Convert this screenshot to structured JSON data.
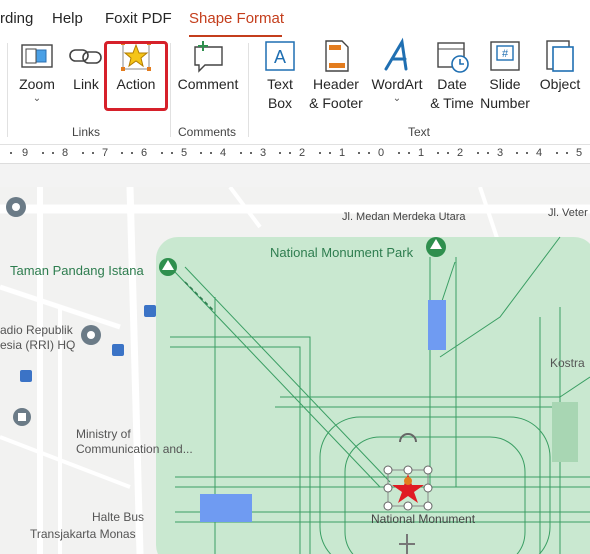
{
  "menu": {
    "items": [
      "rding",
      "Help",
      "Foxit PDF",
      "Shape Format"
    ]
  },
  "ribbon": {
    "buttons": {
      "zoom": "Zoom",
      "link": "Link",
      "action": "Action",
      "comment": "Comment",
      "textbox_1": "Text",
      "textbox_2": "Box",
      "header_1": "Header",
      "header_2": "& Footer",
      "wordart": "WordArt",
      "date_1": "Date",
      "date_2": "& Time",
      "slide_1": "Slide",
      "slide_2": "Number",
      "object": "Object"
    },
    "groups": {
      "links": "Links",
      "comments": "Comments",
      "text": "Text"
    },
    "accent_color": "#c43e1c",
    "highlight_color": "#d6202a"
  },
  "ruler": {
    "labels": [
      "9",
      "8",
      "7",
      "6",
      "5",
      "4",
      "3",
      "2",
      "1",
      "0",
      "1",
      "2",
      "3",
      "4",
      "5"
    ]
  },
  "map": {
    "labels": {
      "street": "Jl. Medan Merdeka Utara",
      "street_right": "Jl. Veter",
      "park": "National Monument Park",
      "taman": "Taman Pandang Istana",
      "radio_1": "adio Republik",
      "radio_2": "esia (RRI) HQ",
      "ministry_1": "Ministry of",
      "ministry_2": "Communication and...",
      "halte_1": "Halte Bus",
      "halte_2": "Transjakarta Monas",
      "monument": "National Monument",
      "kostra": "Kostra"
    },
    "colors": {
      "park": "#c9e8d0",
      "park_lines": "#3a9e63",
      "water": "#6f9bf2",
      "star": "#e01b24"
    }
  }
}
